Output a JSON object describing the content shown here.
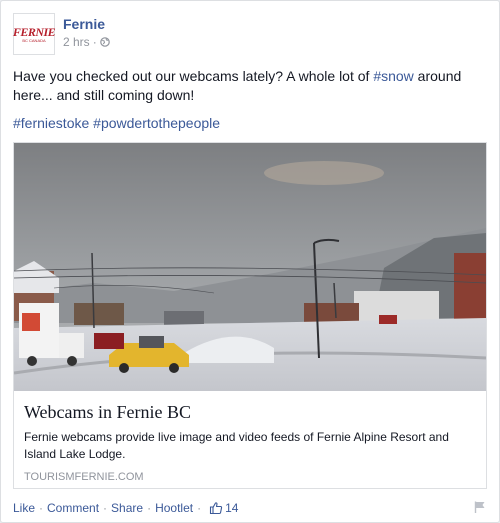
{
  "page": {
    "name": "Fernie",
    "timestamp": "2 hrs",
    "logo_text": "FERNIE",
    "logo_sub": "BC CANADA"
  },
  "post": {
    "text_before": "Have you checked out our webcams lately? A whole lot of ",
    "hashtag_snow": "#snow",
    "text_after": " around here... and still coming down!",
    "hashtag_1": "#ferniestoke",
    "hashtag_2": "#powdertothepeople"
  },
  "attachment": {
    "title": "Webcams in Fernie BC",
    "description": "Fernie webcams provide live image and video feeds of Fernie Alpine Resort and Island Lake Lodge.",
    "domain": "TOURISMFERNIE.COM"
  },
  "footer": {
    "like": "Like",
    "comment": "Comment",
    "share": "Share",
    "hootlet": "Hootlet",
    "like_count": "14"
  },
  "icons": {
    "globe": "globe-icon",
    "thumbs_up": "thumbs-up-icon",
    "flag": "flag-icon"
  },
  "colors": {
    "link": "#3b5998",
    "muted": "#90949c",
    "brand_red": "#b6202c"
  }
}
